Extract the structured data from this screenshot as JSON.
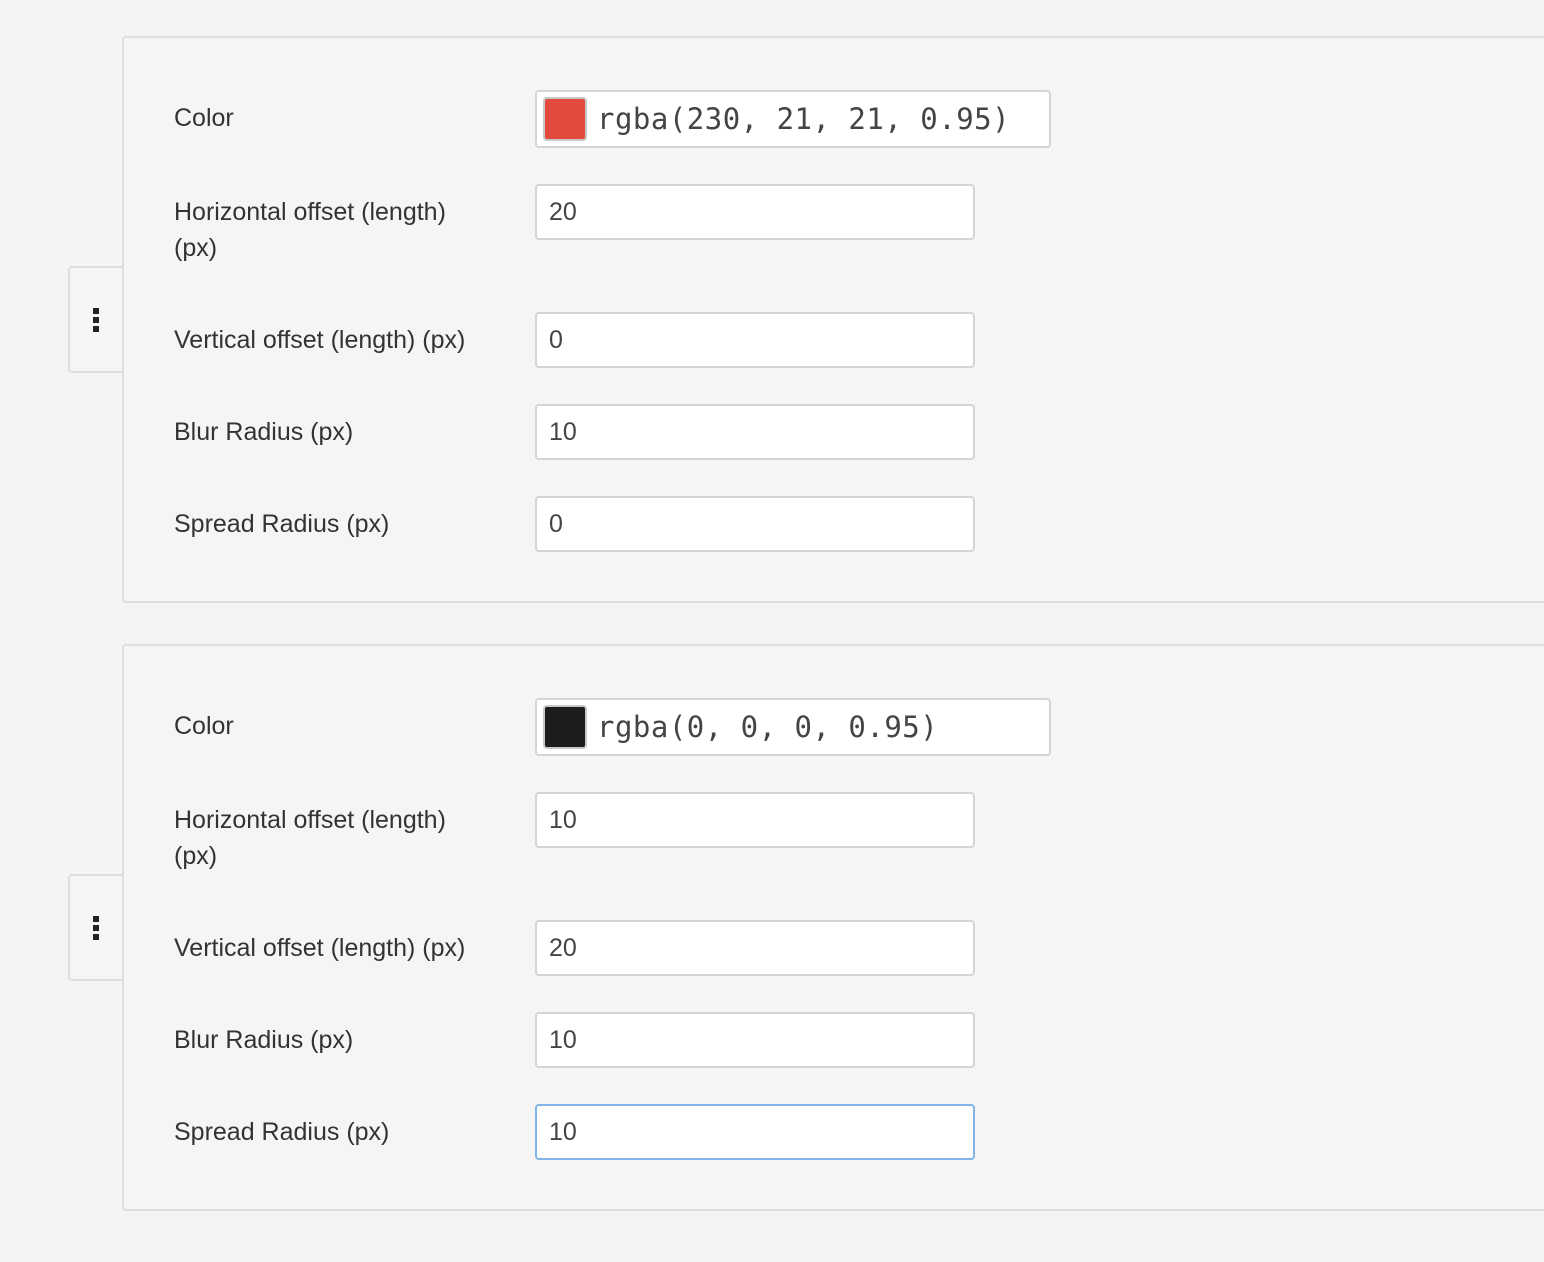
{
  "shadows": [
    {
      "color_label": "Color",
      "color_value": "rgba(230, 21, 21, 0.95)",
      "swatch_color": "#e14a3c",
      "horizontal_label": "Horizontal offset (length)\n(px)",
      "horizontal_value": "20",
      "vertical_label": "Vertical offset (length) (px)",
      "vertical_value": "0",
      "blur_label": "Blur Radius (px)",
      "blur_value": "10",
      "spread_label": "Spread Radius (px)",
      "spread_value": "0"
    },
    {
      "color_label": "Color",
      "color_value": "rgba(0, 0, 0, 0.95)",
      "swatch_color": "#1c1c1c",
      "horizontal_label": "Horizontal offset (length)\n(px)",
      "horizontal_value": "10",
      "vertical_label": "Vertical offset (length) (px)",
      "vertical_value": "20",
      "blur_label": "Blur Radius (px)",
      "blur_value": "10",
      "spread_label": "Spread Radius (px)",
      "spread_value": "10"
    }
  ],
  "focus_border_color": "#82b5e6"
}
